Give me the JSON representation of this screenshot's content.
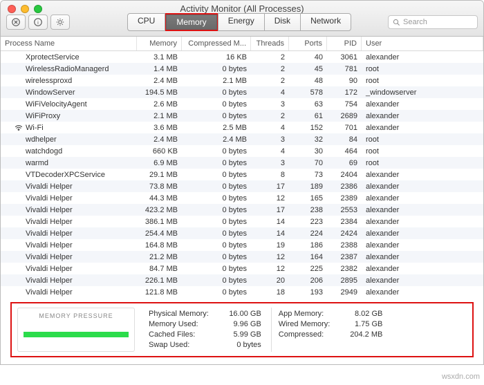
{
  "title": "Activity Monitor (All Processes)",
  "tabs": {
    "cpu": "CPU",
    "memory": "Memory",
    "energy": "Energy",
    "disk": "Disk",
    "network": "Network"
  },
  "search_placeholder": "Search",
  "columns": {
    "name": "Process Name",
    "mem": "Memory",
    "comp": "Compressed M...",
    "thr": "Threads",
    "ports": "Ports",
    "pid": "PID",
    "user": "User"
  },
  "rows": [
    {
      "name": "XprotectService",
      "mem": "3.1 MB",
      "comp": "16 KB",
      "thr": "2",
      "ports": "40",
      "pid": "3061",
      "user": "alexander"
    },
    {
      "name": "WirelessRadioManagerd",
      "mem": "1.4 MB",
      "comp": "0 bytes",
      "thr": "2",
      "ports": "45",
      "pid": "781",
      "user": "root"
    },
    {
      "name": "wirelessproxd",
      "mem": "2.4 MB",
      "comp": "2.1 MB",
      "thr": "2",
      "ports": "48",
      "pid": "90",
      "user": "root"
    },
    {
      "name": "WindowServer",
      "mem": "194.5 MB",
      "comp": "0 bytes",
      "thr": "4",
      "ports": "578",
      "pid": "172",
      "user": "_windowserver"
    },
    {
      "name": "WiFiVelocityAgent",
      "mem": "2.6 MB",
      "comp": "0 bytes",
      "thr": "3",
      "ports": "63",
      "pid": "754",
      "user": "alexander"
    },
    {
      "name": "WiFiProxy",
      "mem": "2.1 MB",
      "comp": "0 bytes",
      "thr": "2",
      "ports": "61",
      "pid": "2689",
      "user": "alexander"
    },
    {
      "name": "Wi-Fi",
      "mem": "3.6 MB",
      "comp": "2.5 MB",
      "thr": "4",
      "ports": "152",
      "pid": "701",
      "user": "alexander",
      "icon": true
    },
    {
      "name": "wdhelper",
      "mem": "2.4 MB",
      "comp": "2.4 MB",
      "thr": "3",
      "ports": "32",
      "pid": "84",
      "user": "root"
    },
    {
      "name": "watchdogd",
      "mem": "660 KB",
      "comp": "0 bytes",
      "thr": "4",
      "ports": "30",
      "pid": "464",
      "user": "root"
    },
    {
      "name": "warmd",
      "mem": "6.9 MB",
      "comp": "0 bytes",
      "thr": "3",
      "ports": "70",
      "pid": "69",
      "user": "root"
    },
    {
      "name": "VTDecoderXPCService",
      "mem": "29.1 MB",
      "comp": "0 bytes",
      "thr": "8",
      "ports": "73",
      "pid": "2404",
      "user": "alexander"
    },
    {
      "name": "Vivaldi Helper",
      "mem": "73.8 MB",
      "comp": "0 bytes",
      "thr": "17",
      "ports": "189",
      "pid": "2386",
      "user": "alexander"
    },
    {
      "name": "Vivaldi Helper",
      "mem": "44.3 MB",
      "comp": "0 bytes",
      "thr": "12",
      "ports": "165",
      "pid": "2389",
      "user": "alexander"
    },
    {
      "name": "Vivaldi Helper",
      "mem": "423.2 MB",
      "comp": "0 bytes",
      "thr": "17",
      "ports": "238",
      "pid": "2553",
      "user": "alexander"
    },
    {
      "name": "Vivaldi Helper",
      "mem": "386.1 MB",
      "comp": "0 bytes",
      "thr": "14",
      "ports": "223",
      "pid": "2384",
      "user": "alexander"
    },
    {
      "name": "Vivaldi Helper",
      "mem": "254.4 MB",
      "comp": "0 bytes",
      "thr": "14",
      "ports": "224",
      "pid": "2424",
      "user": "alexander"
    },
    {
      "name": "Vivaldi Helper",
      "mem": "164.8 MB",
      "comp": "0 bytes",
      "thr": "19",
      "ports": "186",
      "pid": "2388",
      "user": "alexander"
    },
    {
      "name": "Vivaldi Helper",
      "mem": "21.2 MB",
      "comp": "0 bytes",
      "thr": "12",
      "ports": "164",
      "pid": "2387",
      "user": "alexander"
    },
    {
      "name": "Vivaldi Helper",
      "mem": "84.7 MB",
      "comp": "0 bytes",
      "thr": "12",
      "ports": "225",
      "pid": "2382",
      "user": "alexander"
    },
    {
      "name": "Vivaldi Helper",
      "mem": "226.1 MB",
      "comp": "0 bytes",
      "thr": "20",
      "ports": "206",
      "pid": "2895",
      "user": "alexander"
    },
    {
      "name": "Vivaldi Helper",
      "mem": "121.8 MB",
      "comp": "0 bytes",
      "thr": "18",
      "ports": "193",
      "pid": "2949",
      "user": "alexander"
    }
  ],
  "pressure_label": "MEMORY PRESSURE",
  "stats1": {
    "phys_l": "Physical Memory:",
    "phys_v": "16.00 GB",
    "used_l": "Memory Used:",
    "used_v": "9.96 GB",
    "cache_l": "Cached Files:",
    "cache_v": "5.99 GB",
    "swap_l": "Swap Used:",
    "swap_v": "0 bytes"
  },
  "stats2": {
    "app_l": "App Memory:",
    "app_v": "8.02 GB",
    "wired_l": "Wired Memory:",
    "wired_v": "1.75 GB",
    "comp_l": "Compressed:",
    "comp_v": "204.2 MB"
  },
  "watermark": "wsxdn.com"
}
